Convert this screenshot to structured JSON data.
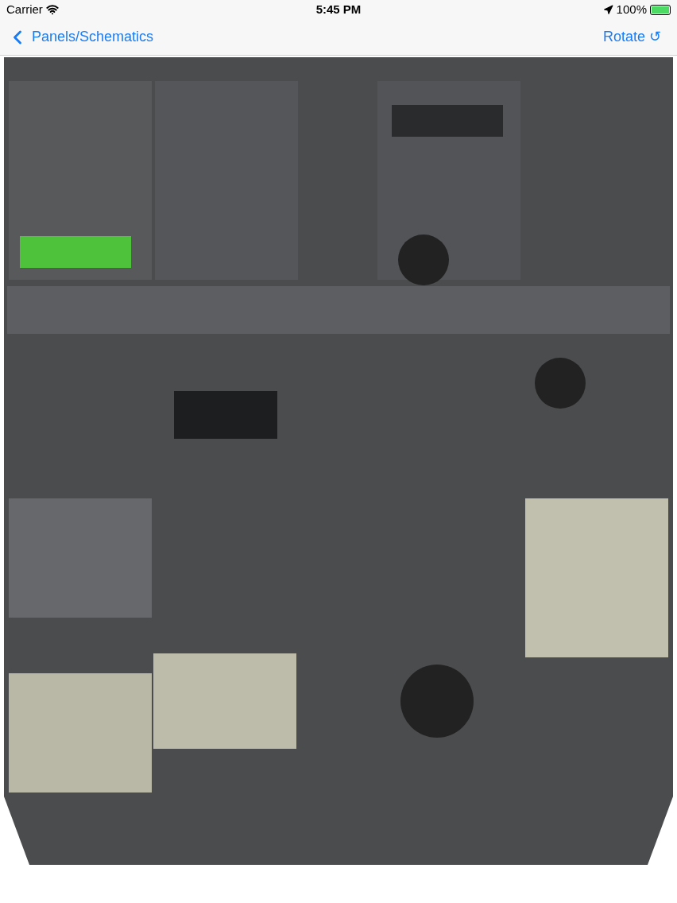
{
  "status_bar": {
    "carrier": "Carrier",
    "time": "5:45 PM",
    "battery": "100%"
  },
  "nav_bar": {
    "back": "Panels/Schematics",
    "action": "Rotate ↺"
  }
}
